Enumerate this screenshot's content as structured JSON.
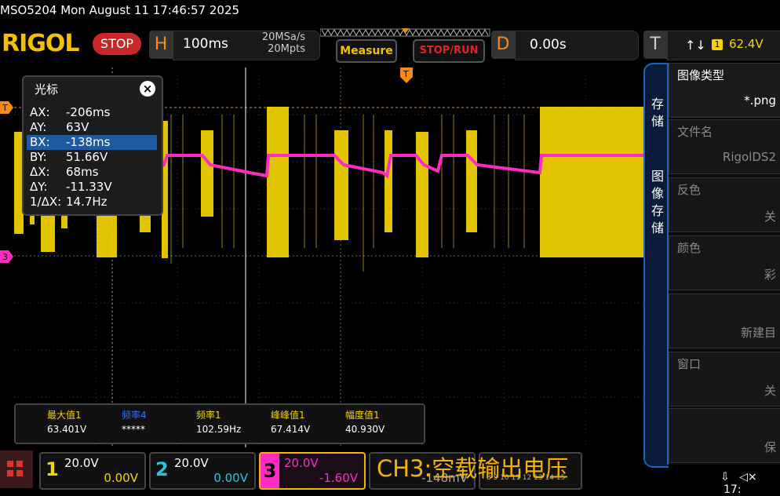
{
  "titlebar": {
    "text": "MSO5204  Mon August 11 17:46:57 2025"
  },
  "topbar": {
    "logo": "RIGOL",
    "run_state": "STOP",
    "horizontal_label": "H",
    "timebase": "100ms",
    "sample_rate": "20MSa/s",
    "memory_depth": "20Mpts",
    "measure_label": "Measure",
    "stoprun_label": "STOP/RUN",
    "delay_label": "D",
    "delay_value": "0.00s",
    "trigger_label": "T",
    "trigger_edge": "↑↓",
    "trigger_source": "1",
    "trigger_level": "62.4V"
  },
  "cursor_panel": {
    "title": "光标",
    "close": "×",
    "rows": [
      {
        "k": "AX:",
        "v": "-206ms"
      },
      {
        "k": "AY:",
        "v": "63V"
      },
      {
        "k": "BX:",
        "v": "-138ms"
      },
      {
        "k": "BY:",
        "v": "51.66V"
      },
      {
        "k": "ΔX:",
        "v": "68ms"
      },
      {
        "k": "ΔY:",
        "v": "-11.33V"
      },
      {
        "k": "1/ΔX:",
        "v": "14.7Hz"
      }
    ]
  },
  "markers": {
    "trigger": "T",
    "ch1": "1",
    "ch3": "3"
  },
  "measurements": [
    {
      "label": "最大值1",
      "value": "63.401V",
      "color": "#f5d400"
    },
    {
      "label": "频率4",
      "value": "*****",
      "color": "#3a6cf5"
    },
    {
      "label": "频率1",
      "value": "102.59Hz",
      "color": "#f5d400"
    },
    {
      "label": "峰峰值1",
      "value": "67.414V",
      "color": "#f5d400"
    },
    {
      "label": "幅度值1",
      "value": "40.930V",
      "color": "#f5d400"
    }
  ],
  "channels": [
    {
      "num": "1",
      "scale": "20.0V",
      "offset": "0.00V",
      "color": "#f5d400"
    },
    {
      "num": "2",
      "scale": "20.0V",
      "offset": "0.00V",
      "color": "#22c8e0"
    },
    {
      "num": "3",
      "scale": "20.0V",
      "offset": "-1.60V",
      "color": "#ff2cc4"
    }
  ],
  "partial_channel": {
    "scale_fragment": "-148mV",
    "digital_fragment": "8 9 10 11 12 13 14 15"
  },
  "note": "CH3:空载输出电压",
  "side_tabs": [
    "存储",
    "图像存储"
  ],
  "side_items": [
    {
      "label": "图像类型",
      "value": "*.png"
    },
    {
      "label": "文件名",
      "value": "RigolDS2"
    },
    {
      "label": "反色",
      "value": "关"
    },
    {
      "label": "颜色",
      "value": "彩"
    },
    {
      "label": "",
      "value": "新建目"
    },
    {
      "label": "窗口",
      "value": "关"
    },
    {
      "label": "",
      "value": "保"
    }
  ],
  "status": {
    "time": "17:"
  },
  "colors": {
    "ch1": "#f5d400",
    "ch2": "#22c8e0",
    "ch3": "#ff2cc4",
    "accent": "#f58a14",
    "panel_border": "#1b63b8"
  }
}
